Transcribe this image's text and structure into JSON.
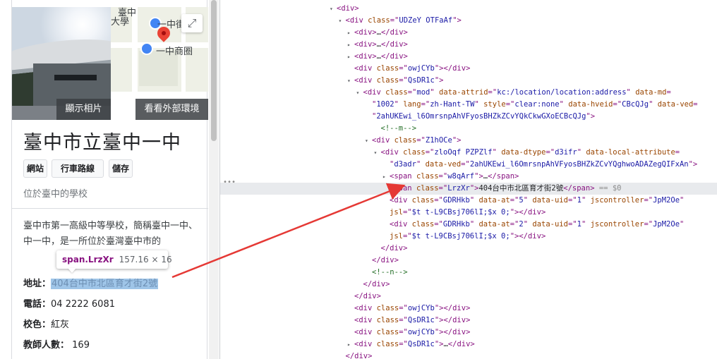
{
  "panel": {
    "map_labels": [
      "臺中",
      "一中街",
      "一中商圈",
      "大學"
    ],
    "photo_label": "顯示相片",
    "outside_label": "看看外部環境",
    "expand_icon": "expand-icon",
    "title": "臺中市立臺中一中",
    "chips": [
      "網站",
      "行車路線",
      "儲存"
    ],
    "subtitle": "位於臺中的學校",
    "description": "臺中市第一高級中等學校，簡稱臺中一中、中一中，是一所位於臺灣臺中市的",
    "facts": {
      "address_label": "地址：",
      "address_value": "404台中市北區育才街2號",
      "phone_label": "電話：",
      "phone_value": "04 2222 6081",
      "color_label": "校色：",
      "color_value": "紅灰",
      "teachers_label": "教師人數：",
      "teachers_value": "169"
    }
  },
  "tooltip": {
    "selector": "span.LrzXr",
    "size": "157.16 × 16"
  },
  "devtools": {
    "lines": [
      {
        "indent": 14,
        "tri": "▾",
        "html": [
          [
            "tag",
            "<div>"
          ]
        ]
      },
      {
        "indent": 15,
        "tri": "▾",
        "html": [
          [
            "tag",
            "<div "
          ],
          [
            "attr",
            "class"
          ],
          [
            "tag",
            "=\""
          ],
          [
            "val",
            "UDZeY OTFaAf"
          ],
          [
            "tag",
            "\">"
          ]
        ]
      },
      {
        "indent": 16,
        "tri": "▸",
        "html": [
          [
            "tag",
            "<div>"
          ],
          [
            "txt",
            "…"
          ],
          [
            "tag",
            "</div>"
          ]
        ]
      },
      {
        "indent": 16,
        "tri": "▸",
        "html": [
          [
            "tag",
            "<div>"
          ],
          [
            "txt",
            "…"
          ],
          [
            "tag",
            "</div>"
          ]
        ]
      },
      {
        "indent": 16,
        "tri": "▸",
        "html": [
          [
            "tag",
            "<div>"
          ],
          [
            "txt",
            "…"
          ],
          [
            "tag",
            "</div>"
          ]
        ]
      },
      {
        "indent": 16,
        "tri": "",
        "html": [
          [
            "tag",
            "<div "
          ],
          [
            "attr",
            "class"
          ],
          [
            "tag",
            "=\""
          ],
          [
            "val",
            "owjCYb"
          ],
          [
            "tag",
            "\"></div>"
          ]
        ]
      },
      {
        "indent": 16,
        "tri": "▾",
        "html": [
          [
            "tag",
            "<div "
          ],
          [
            "attr",
            "class"
          ],
          [
            "tag",
            "=\""
          ],
          [
            "val",
            "QsDR1c"
          ],
          [
            "tag",
            "\">"
          ]
        ]
      },
      {
        "indent": 17,
        "tri": "▾",
        "html": [
          [
            "tag",
            "<div "
          ],
          [
            "attr",
            "class"
          ],
          [
            "tag",
            "=\""
          ],
          [
            "val",
            "mod"
          ],
          [
            "tag",
            "\" "
          ],
          [
            "attr",
            "data-attrid"
          ],
          [
            "tag",
            "=\""
          ],
          [
            "val",
            "kc:/location/location:address"
          ],
          [
            "tag",
            "\" "
          ],
          [
            "attr",
            "data-md"
          ],
          [
            "tag",
            "="
          ]
        ]
      },
      {
        "indent": 18,
        "tri": "",
        "html": [
          [
            "tag",
            "\""
          ],
          [
            "val",
            "1002"
          ],
          [
            "tag",
            "\" "
          ],
          [
            "attr",
            "lang"
          ],
          [
            "tag",
            "=\""
          ],
          [
            "val",
            "zh-Hant-TW"
          ],
          [
            "tag",
            "\" "
          ],
          [
            "attr",
            "style"
          ],
          [
            "tag",
            "=\""
          ],
          [
            "val",
            "clear:none"
          ],
          [
            "tag",
            "\" "
          ],
          [
            "attr",
            "data-hveid"
          ],
          [
            "tag",
            "=\""
          ],
          [
            "val",
            "CBcQJg"
          ],
          [
            "tag",
            "\" "
          ],
          [
            "attr",
            "data-ved"
          ],
          [
            "tag",
            "="
          ]
        ]
      },
      {
        "indent": 18,
        "tri": "",
        "html": [
          [
            "tag",
            "\""
          ],
          [
            "val",
            "2ahUKEwi_l6OmrsnpAhVFyosBHZkZCvYQkCkwGXoECBcQJg"
          ],
          [
            "tag",
            "\">"
          ]
        ]
      },
      {
        "indent": 19,
        "tri": "",
        "html": [
          [
            "cmt",
            "<!--m-->"
          ]
        ]
      },
      {
        "indent": 18,
        "tri": "▾",
        "html": [
          [
            "tag",
            "<div "
          ],
          [
            "attr",
            "class"
          ],
          [
            "tag",
            "=\""
          ],
          [
            "val",
            "Z1hOCe"
          ],
          [
            "tag",
            "\">"
          ]
        ]
      },
      {
        "indent": 19,
        "tri": "▾",
        "html": [
          [
            "tag",
            "<div "
          ],
          [
            "attr",
            "class"
          ],
          [
            "tag",
            "=\""
          ],
          [
            "val",
            "zloOqf PZPZlf"
          ],
          [
            "tag",
            "\" "
          ],
          [
            "attr",
            "data-dtype"
          ],
          [
            "tag",
            "=\""
          ],
          [
            "val",
            "d3ifr"
          ],
          [
            "tag",
            "\" "
          ],
          [
            "attr",
            "data-local-attribute"
          ],
          [
            "tag",
            "="
          ]
        ]
      },
      {
        "indent": 20,
        "tri": "",
        "html": [
          [
            "tag",
            "\""
          ],
          [
            "val",
            "d3adr"
          ],
          [
            "tag",
            "\" "
          ],
          [
            "attr",
            "data-ved"
          ],
          [
            "tag",
            "=\""
          ],
          [
            "val",
            "2ahUKEwi_l6OmrsnpAhVFyosBHZkZCvYQghwoADAZegQIFxAn"
          ],
          [
            "tag",
            "\">"
          ]
        ]
      },
      {
        "indent": 20,
        "tri": "▸",
        "html": [
          [
            "tag",
            "<span "
          ],
          [
            "attr",
            "class"
          ],
          [
            "tag",
            "=\""
          ],
          [
            "val",
            "w8qArf"
          ],
          [
            "tag",
            "\">"
          ],
          [
            "txt",
            "…"
          ],
          [
            "tag",
            "</span>"
          ]
        ]
      },
      {
        "indent": 20,
        "tri": "",
        "hl": true,
        "html": [
          [
            "tag",
            "<span "
          ],
          [
            "attr",
            "class"
          ],
          [
            "tag",
            "=\""
          ],
          [
            "val",
            "LrzXr"
          ],
          [
            "tag",
            "\">"
          ],
          [
            "txt",
            "404台中市北區育才街2號"
          ],
          [
            "tag",
            "</span>"
          ],
          [
            "dim",
            " == $0"
          ]
        ]
      },
      {
        "indent": 20,
        "tri": "",
        "html": [
          [
            "tag",
            "<div "
          ],
          [
            "attr",
            "class"
          ],
          [
            "tag",
            "=\""
          ],
          [
            "val",
            "GDRHkb"
          ],
          [
            "tag",
            "\" "
          ],
          [
            "attr",
            "data-at"
          ],
          [
            "tag",
            "=\""
          ],
          [
            "val",
            "5"
          ],
          [
            "tag",
            "\" "
          ],
          [
            "attr",
            "data-uid"
          ],
          [
            "tag",
            "=\""
          ],
          [
            "val",
            "1"
          ],
          [
            "tag",
            "\" "
          ],
          [
            "attr",
            "jscontroller"
          ],
          [
            "tag",
            "=\""
          ],
          [
            "val",
            "JpM2Oe"
          ],
          [
            "tag",
            "\""
          ]
        ]
      },
      {
        "indent": 20,
        "tri": "",
        "html": [
          [
            "attr",
            "jsl"
          ],
          [
            "tag",
            "=\""
          ],
          [
            "val",
            "$t t-L9CBsj706lI;$x 0;"
          ],
          [
            "tag",
            "\"></div>"
          ]
        ]
      },
      {
        "indent": 20,
        "tri": "",
        "html": [
          [
            "tag",
            "<div "
          ],
          [
            "attr",
            "class"
          ],
          [
            "tag",
            "=\""
          ],
          [
            "val",
            "GDRHkb"
          ],
          [
            "tag",
            "\" "
          ],
          [
            "attr",
            "data-at"
          ],
          [
            "tag",
            "=\""
          ],
          [
            "val",
            "2"
          ],
          [
            "tag",
            "\" "
          ],
          [
            "attr",
            "data-uid"
          ],
          [
            "tag",
            "=\""
          ],
          [
            "val",
            "1"
          ],
          [
            "tag",
            "\" "
          ],
          [
            "attr",
            "jscontroller"
          ],
          [
            "tag",
            "=\""
          ],
          [
            "val",
            "JpM2Oe"
          ],
          [
            "tag",
            "\""
          ]
        ]
      },
      {
        "indent": 20,
        "tri": "",
        "html": [
          [
            "attr",
            "jsl"
          ],
          [
            "tag",
            "=\""
          ],
          [
            "val",
            "$t t-L9CBsj706lI;$x 0;"
          ],
          [
            "tag",
            "\"></div>"
          ]
        ]
      },
      {
        "indent": 19,
        "tri": "",
        "html": [
          [
            "tag",
            "</div>"
          ]
        ]
      },
      {
        "indent": 18,
        "tri": "",
        "html": [
          [
            "tag",
            "</div>"
          ]
        ]
      },
      {
        "indent": 18,
        "tri": "",
        "html": [
          [
            "cmt",
            "<!--n-->"
          ]
        ]
      },
      {
        "indent": 17,
        "tri": "",
        "html": [
          [
            "tag",
            "</div>"
          ]
        ]
      },
      {
        "indent": 16,
        "tri": "",
        "html": [
          [
            "tag",
            "</div>"
          ]
        ]
      },
      {
        "indent": 16,
        "tri": "",
        "html": [
          [
            "tag",
            "<div "
          ],
          [
            "attr",
            "class"
          ],
          [
            "tag",
            "=\""
          ],
          [
            "val",
            "owjCYb"
          ],
          [
            "tag",
            "\"></div>"
          ]
        ]
      },
      {
        "indent": 16,
        "tri": "",
        "html": [
          [
            "tag",
            "<div "
          ],
          [
            "attr",
            "class"
          ],
          [
            "tag",
            "=\""
          ],
          [
            "val",
            "QsDR1c"
          ],
          [
            "tag",
            "\"></div>"
          ]
        ]
      },
      {
        "indent": 16,
        "tri": "",
        "html": [
          [
            "tag",
            "<div "
          ],
          [
            "attr",
            "class"
          ],
          [
            "tag",
            "=\""
          ],
          [
            "val",
            "owjCYb"
          ],
          [
            "tag",
            "\"></div>"
          ]
        ]
      },
      {
        "indent": 16,
        "tri": "▸",
        "html": [
          [
            "tag",
            "<div "
          ],
          [
            "attr",
            "class"
          ],
          [
            "tag",
            "=\""
          ],
          [
            "val",
            "QsDR1c"
          ],
          [
            "tag",
            "\">"
          ],
          [
            "txt",
            "…"
          ],
          [
            "tag",
            "</div>"
          ]
        ]
      },
      {
        "indent": 15,
        "tri": "",
        "html": [
          [
            "tag",
            "</div>"
          ]
        ]
      }
    ],
    "ellipsis": "•••"
  },
  "colors": {
    "arrow": "#e53935",
    "highlight_row": "#e8eaed",
    "selection": "#9fc5e8"
  }
}
